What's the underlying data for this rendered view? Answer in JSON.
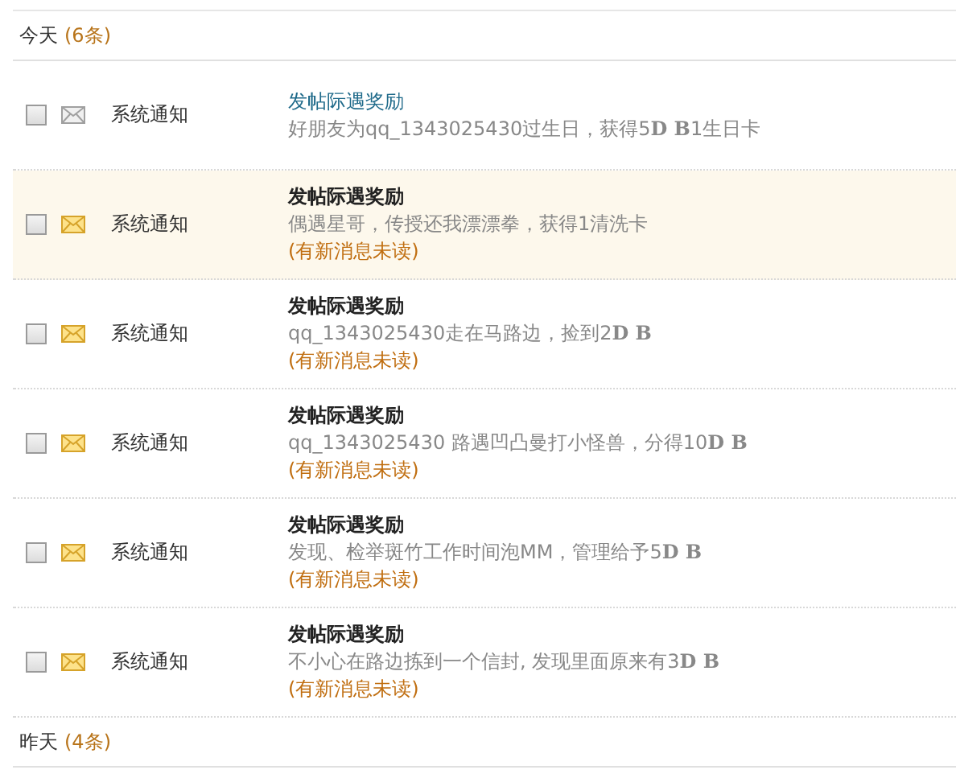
{
  "groups": [
    {
      "label": "今天",
      "count": "(6条)",
      "messages": [
        {
          "checked": false,
          "read": true,
          "highlighted": false,
          "sender": "系统通知",
          "title": "发帖际遇奖励",
          "body": "好朋友为qq_1343025430过生日，获得5**D B**1生日卡"
        },
        {
          "checked": false,
          "read": false,
          "highlighted": true,
          "sender": "系统通知",
          "title": "发帖际遇奖励",
          "body": "偶遇星哥，传授还我漂漂拳，获得1清洗卡",
          "note": "(有新消息未读)"
        },
        {
          "checked": false,
          "read": false,
          "highlighted": false,
          "sender": "系统通知",
          "title": "发帖际遇奖励",
          "body": "qq_1343025430走在马路边，捡到2**D B**",
          "note": "(有新消息未读)"
        },
        {
          "checked": false,
          "read": false,
          "highlighted": false,
          "sender": "系统通知",
          "title": "发帖际遇奖励",
          "body": "qq_1343025430 路遇凹凸曼打小怪兽，分得10**D B**",
          "note": "(有新消息未读)"
        },
        {
          "checked": false,
          "read": false,
          "highlighted": false,
          "sender": "系统通知",
          "title": "发帖际遇奖励",
          "body": "发现、检举斑竹工作时间泡MM，管理给予5**D B**",
          "note": "(有新消息未读)"
        },
        {
          "checked": false,
          "read": false,
          "highlighted": false,
          "sender": "系统通知",
          "title": "发帖际遇奖励",
          "body": "不小心在路边拣到一个信封, 发现里面原来有3**D B**",
          "note": "(有新消息未读)"
        }
      ]
    },
    {
      "label": "昨天",
      "count": "(4条)"
    }
  ]
}
